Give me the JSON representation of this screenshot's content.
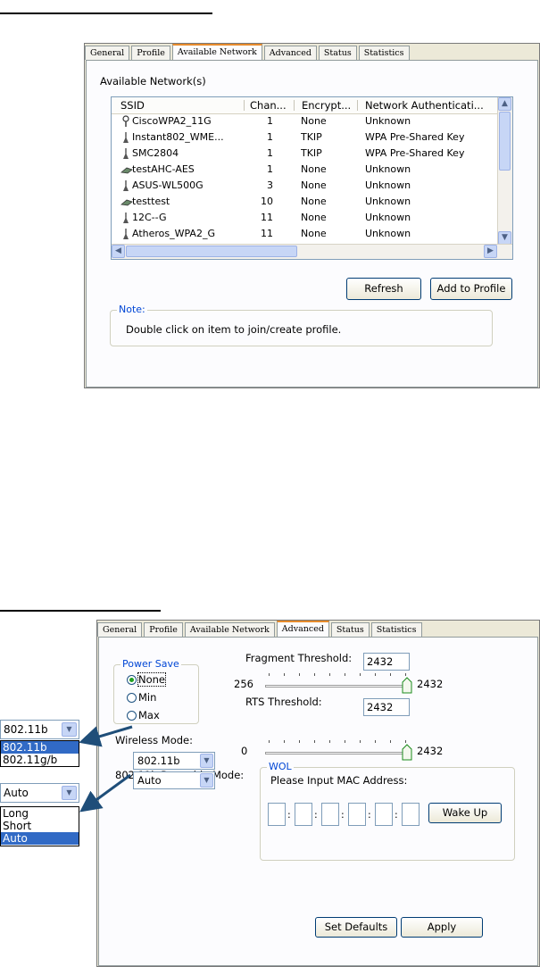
{
  "tabs": [
    "General",
    "Profile",
    "Available Network",
    "Advanced",
    "Status",
    "Statistics"
  ],
  "available_network": {
    "active_tab": "Available Network",
    "section_label": "Available Network(s)",
    "columns": [
      "SSID",
      "Chan...",
      "Encrypt...",
      "Network Authenticati..."
    ],
    "rows": [
      {
        "icon": "antenna-icon",
        "ssid": "CiscoWPA2_11G",
        "chan": "1",
        "encrypt": "None",
        "auth": "Unknown"
      },
      {
        "icon": "ap-icon",
        "ssid": "Instant802_WME...",
        "chan": "1",
        "encrypt": "TKIP",
        "auth": "WPA Pre-Shared Key"
      },
      {
        "icon": "ap-icon",
        "ssid": "SMC2804",
        "chan": "1",
        "encrypt": "TKIP",
        "auth": "WPA Pre-Shared Key"
      },
      {
        "icon": "adhoc-icon",
        "ssid": "testAHC-AES",
        "chan": "1",
        "encrypt": "None",
        "auth": "Unknown"
      },
      {
        "icon": "ap-icon",
        "ssid": "ASUS-WL500G",
        "chan": "3",
        "encrypt": "None",
        "auth": "Unknown"
      },
      {
        "icon": "adhoc-icon",
        "ssid": "testtest",
        "chan": "10",
        "encrypt": "None",
        "auth": "Unknown"
      },
      {
        "icon": "ap-icon",
        "ssid": "12C--G",
        "chan": "11",
        "encrypt": "None",
        "auth": "Unknown"
      },
      {
        "icon": "ap-icon",
        "ssid": "Atheros_WPA2_G",
        "chan": "11",
        "encrypt": "None",
        "auth": "Unknown"
      }
    ],
    "refresh_label": "Refresh",
    "add_profile_label": "Add to Profile",
    "note_label": "Note:",
    "note_text": "Double click on item to join/create profile."
  },
  "advanced": {
    "active_tab": "Advanced",
    "power_save": {
      "label": "Power Save",
      "options": [
        "None",
        "Min",
        "Max"
      ],
      "selected": "None"
    },
    "fragment_threshold": {
      "label": "Fragment Threshold:",
      "value": "2432",
      "min": "256",
      "max": "2432"
    },
    "rts_threshold": {
      "label": "RTS Threshold:",
      "value": "2432",
      "min": "0",
      "max": "2432"
    },
    "wireless_mode": {
      "label": "Wireless Mode:",
      "value": "802.11b"
    },
    "preamble_mode": {
      "label": "802.11b Preamble Mode:",
      "value": "Auto"
    },
    "wol": {
      "label": "WOL",
      "prompt": "Please Input MAC Address:",
      "separator": ":",
      "wake_label": "Wake Up"
    },
    "set_defaults_label": "Set Defaults",
    "apply_label": "Apply"
  },
  "callouts": {
    "wireless_mode": {
      "value": "802.11b",
      "options": [
        "802.11b",
        "802.11g/b"
      ],
      "selected": "802.11b"
    },
    "preamble": {
      "value": "Auto",
      "options": [
        "Long",
        "Short",
        "Auto"
      ],
      "selected": "Auto"
    }
  },
  "colors": {
    "tab_accent": "#e68b2c",
    "legend_blue": "#0046d5",
    "selection": "#316ac5",
    "arrow": "#1f4e79"
  }
}
